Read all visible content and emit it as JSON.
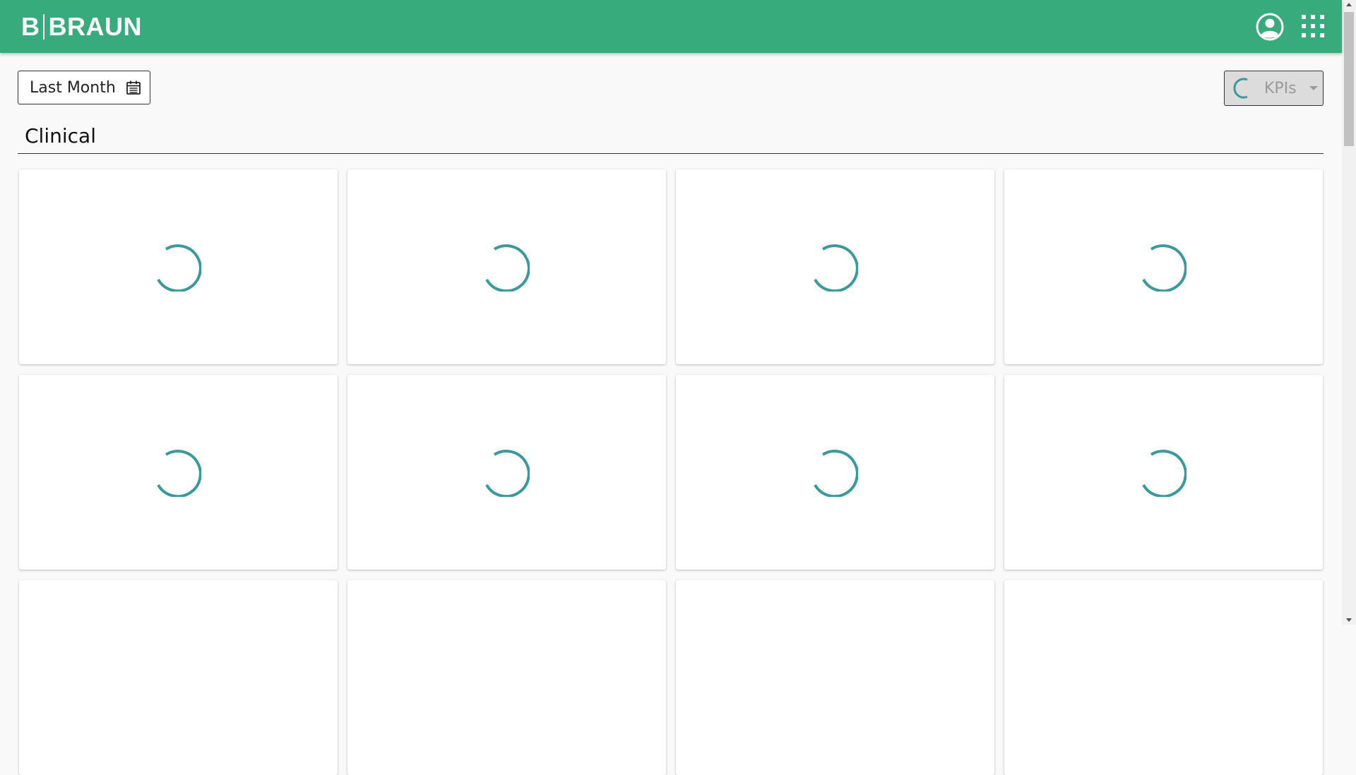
{
  "app": {
    "brand_left": "B",
    "brand_right": "BRAUN",
    "brand_color": "#37ab7b",
    "accent_color": "#3a9a9b"
  },
  "header": {
    "icons": [
      "account-circle-icon",
      "apps-grid-icon"
    ]
  },
  "toolbar": {
    "date_range_label": "Last Month",
    "date_range_icon": "calendar-icon",
    "kpi_select_label": "KPIs",
    "kpi_select_state": "loading"
  },
  "sections": [
    {
      "title": "Clinical",
      "cards": [
        {
          "state": "loading"
        },
        {
          "state": "loading"
        },
        {
          "state": "loading"
        },
        {
          "state": "loading"
        },
        {
          "state": "loading"
        },
        {
          "state": "loading"
        },
        {
          "state": "loading"
        },
        {
          "state": "loading"
        },
        {
          "state": "loading"
        },
        {
          "state": "loading"
        },
        {
          "state": "loading"
        },
        {
          "state": "loading"
        }
      ]
    }
  ]
}
